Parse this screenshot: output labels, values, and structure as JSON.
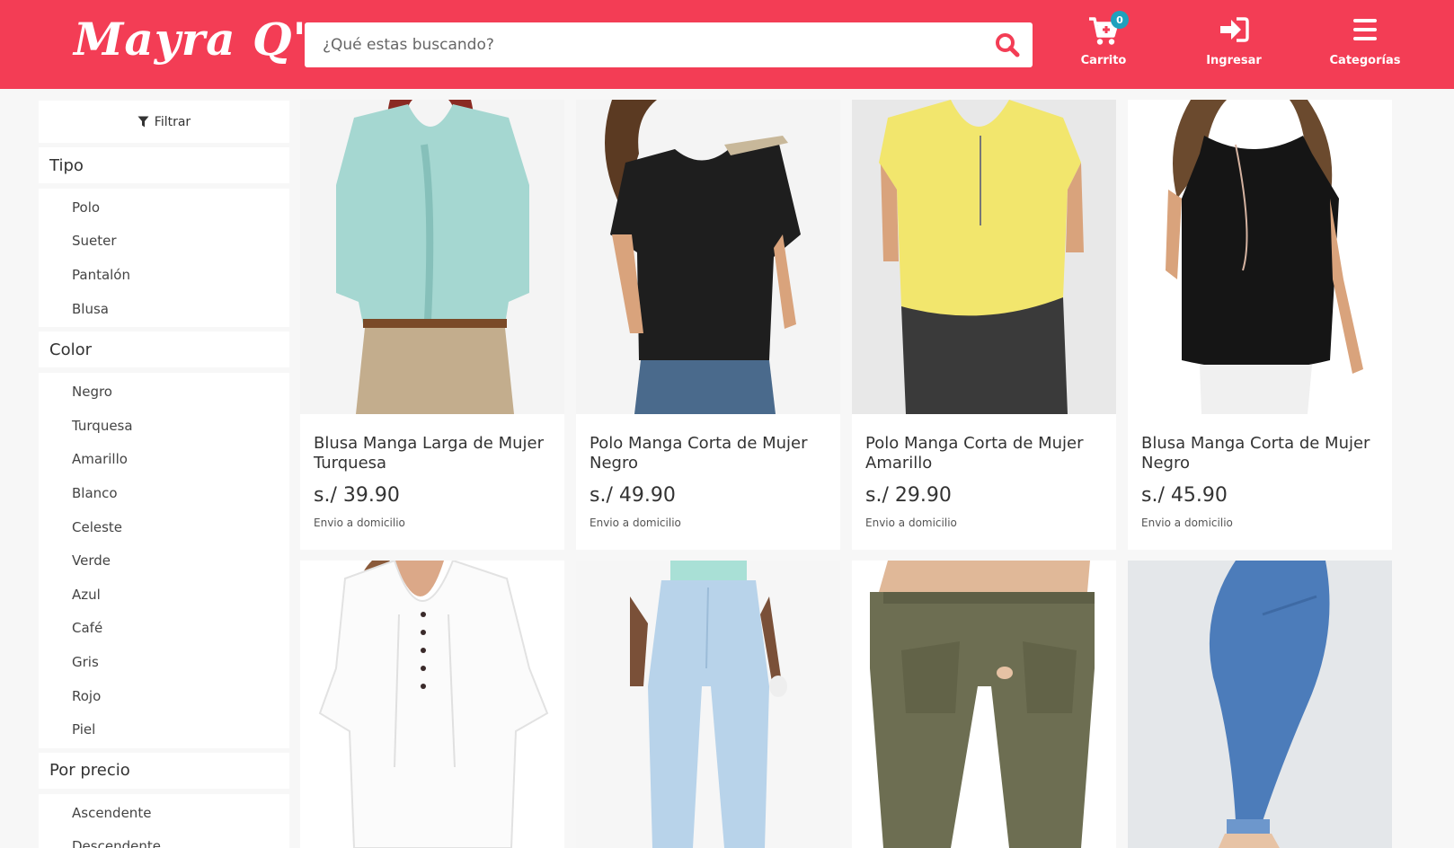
{
  "header": {
    "logo": "Mayra Q'",
    "search_placeholder": "¿Qué estas buscando?",
    "cart_label": "Carrito",
    "cart_count": "0",
    "login_label": "Ingresar",
    "categories_label": "Categorías",
    "brand_color": "#f33d55"
  },
  "sidebar": {
    "filter_label": "Filtrar",
    "sections": [
      {
        "title": "Tipo",
        "options": [
          "Polo",
          "Sueter",
          "Pantalón",
          "Blusa"
        ]
      },
      {
        "title": "Color",
        "options": [
          "Negro",
          "Turquesa",
          "Amarillo",
          "Blanco",
          "Celeste",
          "Verde",
          "Azul",
          "Café",
          "Gris",
          "Rojo",
          "Piel"
        ]
      },
      {
        "title": "Por precio",
        "options": [
          "Ascendente",
          "Descendente"
        ]
      }
    ]
  },
  "products": [
    {
      "name": "Blusa Manga Larga de Mujer Turquesa",
      "price": "s./ 39.90",
      "shipping": "Envio a domicilio",
      "image": "turquoise-ruffle-blouse"
    },
    {
      "name": "Polo Manga Corta de Mujer Negro",
      "price": "s./ 49.90",
      "shipping": "Envio a domicilio",
      "image": "black-one-shoulder-top"
    },
    {
      "name": "Polo Manga Corta de Mujer Amarillo",
      "price": "s./ 29.90",
      "shipping": "Envio a domicilio",
      "image": "yellow-zip-top"
    },
    {
      "name": "Blusa Manga Corta de Mujer Negro",
      "price": "s./ 45.90",
      "shipping": "Envio a domicilio",
      "image": "black-cold-shoulder-blouse"
    },
    {
      "name": "",
      "price": "",
      "shipping": "",
      "image": "white-pleated-blouse"
    },
    {
      "name": "",
      "price": "",
      "shipping": "",
      "image": "light-blue-mom-jeans"
    },
    {
      "name": "",
      "price": "",
      "shipping": "",
      "image": "olive-cargo-pants"
    },
    {
      "name": "",
      "price": "",
      "shipping": "",
      "image": "blue-skinny-jeans"
    }
  ]
}
